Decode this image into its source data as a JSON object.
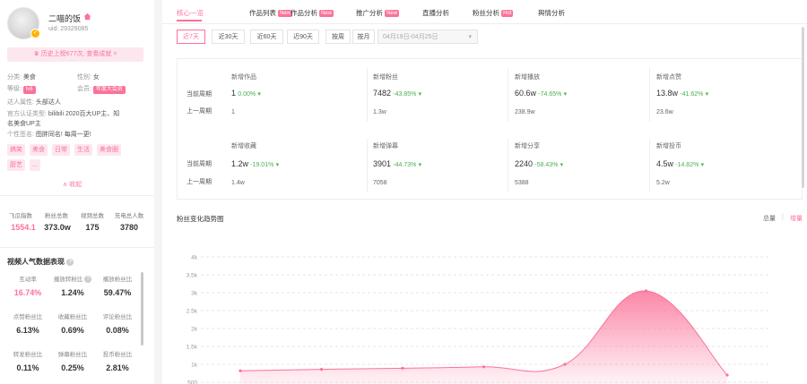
{
  "profile": {
    "name": "二喵的饭",
    "uid": "uid: 29329085",
    "banner": "历史上榜677次, 查看成就 >",
    "category_label": "分类:",
    "category": "美食",
    "gender_label": "性别:",
    "gender": "女",
    "level_label": "等级:",
    "level": "lv6",
    "member_label": "会员:",
    "member": "年度大会员",
    "expert_label": "达人属性:",
    "expert": "头部达人",
    "cert_label": "官方认证类型:",
    "cert_line1": "bilibili 2020百大UP主、知",
    "cert_line2": "名美食UP主",
    "sign_label": "个性签名:",
    "sign": "图胖同名! 每周一更!",
    "tags": [
      "搞笑",
      "美食",
      "日常",
      "生活",
      "美食圈",
      "厨艺",
      "..."
    ],
    "collapse": "∧ 收起"
  },
  "summary": {
    "labels": [
      "飞瓜指数",
      "粉丝总数",
      "视频总数",
      "充电总人数"
    ],
    "values": [
      "1554.1",
      "373.0w",
      "175",
      "3780"
    ]
  },
  "popularity": {
    "title": "视频人气数据表现",
    "cells": [
      {
        "label": "互动率",
        "value": "16.74%"
      },
      {
        "label": "播放转粉比",
        "value": "1.24%"
      },
      {
        "label": "播放粉丝比",
        "value": "59.47%"
      },
      {
        "label": "点赞粉丝比",
        "value": "6.13%"
      },
      {
        "label": "收藏粉丝比",
        "value": "0.69%"
      },
      {
        "label": "评论粉丝比",
        "value": "0.08%"
      },
      {
        "label": "转发粉丝比",
        "value": "0.11%"
      },
      {
        "label": "弹幕粉丝比",
        "value": "0.25%"
      },
      {
        "label": "投币粉丝比",
        "value": "2.81%"
      }
    ]
  },
  "tabs": [
    {
      "label": "核心一览",
      "badge": ""
    },
    {
      "label": "作品列表",
      "badge": "New"
    },
    {
      "label": "作品分析",
      "badge": "New"
    },
    {
      "label": "推广分析",
      "badge": "New"
    },
    {
      "label": "直播分析",
      "badge": ""
    },
    {
      "label": "粉丝分析",
      "badge": "Hot"
    },
    {
      "label": "舆情分析",
      "badge": ""
    }
  ],
  "ranges": [
    "近7天",
    "近30天",
    "近60天",
    "近90天",
    "按周",
    "按月"
  ],
  "date_range": "04月19日-04月25日",
  "row_labels": {
    "current": "当前周期",
    "previous": "上一周期"
  },
  "metrics": [
    {
      "title": "新增作品",
      "value": "1",
      "pct": "0.00%",
      "prev": "1"
    },
    {
      "title": "新增粉丝",
      "value": "7482",
      "pct": "-43.85%",
      "prev": "1.3w"
    },
    {
      "title": "新增播放",
      "value": "60.6w",
      "pct": "-74.65%",
      "prev": "238.9w"
    },
    {
      "title": "新增点赞",
      "value": "13.8w",
      "pct": "-41.62%",
      "prev": "23.6w"
    },
    {
      "title": "新增收藏",
      "value": "1.2w",
      "pct": "-19.01%",
      "prev": "1.4w"
    },
    {
      "title": "新增弹幕",
      "value": "3901",
      "pct": "-44.73%",
      "prev": "7058"
    },
    {
      "title": "新增分享",
      "value": "2240",
      "pct": "-58.43%",
      "prev": "5388"
    },
    {
      "title": "新增投币",
      "value": "4.5w",
      "pct": "-14.82%",
      "prev": "5.2w"
    }
  ],
  "chart_section": {
    "title": "粉丝变化趋势图",
    "toggle_total": "总量",
    "toggle_sep": "|",
    "toggle_inc": "增量"
  },
  "chart_data": {
    "type": "area",
    "y_ticks": [
      "4k",
      "3.5k",
      "3k",
      "2.5k",
      "2k",
      "1.5k",
      "1k",
      "500"
    ],
    "ylim": [
      500,
      4000
    ],
    "values": [
      820,
      860,
      890,
      930,
      1000,
      3050,
      700
    ],
    "x": [],
    "color": "#fb7299"
  },
  "colors": {
    "accent": "#fb7299",
    "down": "#4caf50"
  }
}
